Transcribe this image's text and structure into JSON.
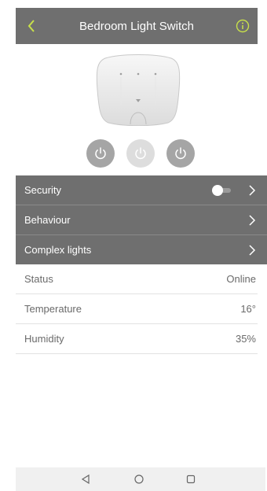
{
  "header": {
    "title": "Bedroom Light Switch",
    "back_icon": "chevron-left-icon",
    "info_icon": "info-icon",
    "accent_color": "#c8e04a",
    "background_color": "#6f6f6f"
  },
  "device": {
    "image": "light-switch-device"
  },
  "power_buttons": [
    {
      "icon": "power-icon",
      "color": "#a5a5a5"
    },
    {
      "icon": "power-icon",
      "color": "#dddddd"
    },
    {
      "icon": "power-icon",
      "color": "#a5a5a5"
    }
  ],
  "menu": {
    "security": {
      "label": "Security",
      "toggle_on": false
    },
    "behaviour": {
      "label": "Behaviour"
    },
    "complex_lights": {
      "label": "Complex lights"
    }
  },
  "info": {
    "status": {
      "label": "Status",
      "value": "Online"
    },
    "temperature": {
      "label": "Temperature",
      "value": "16°"
    },
    "humidity": {
      "label": "Humidity",
      "value": "35%"
    }
  },
  "navbar": {
    "back_icon": "triangle-back-icon",
    "home_icon": "circle-home-icon",
    "recent_icon": "square-recent-icon"
  }
}
